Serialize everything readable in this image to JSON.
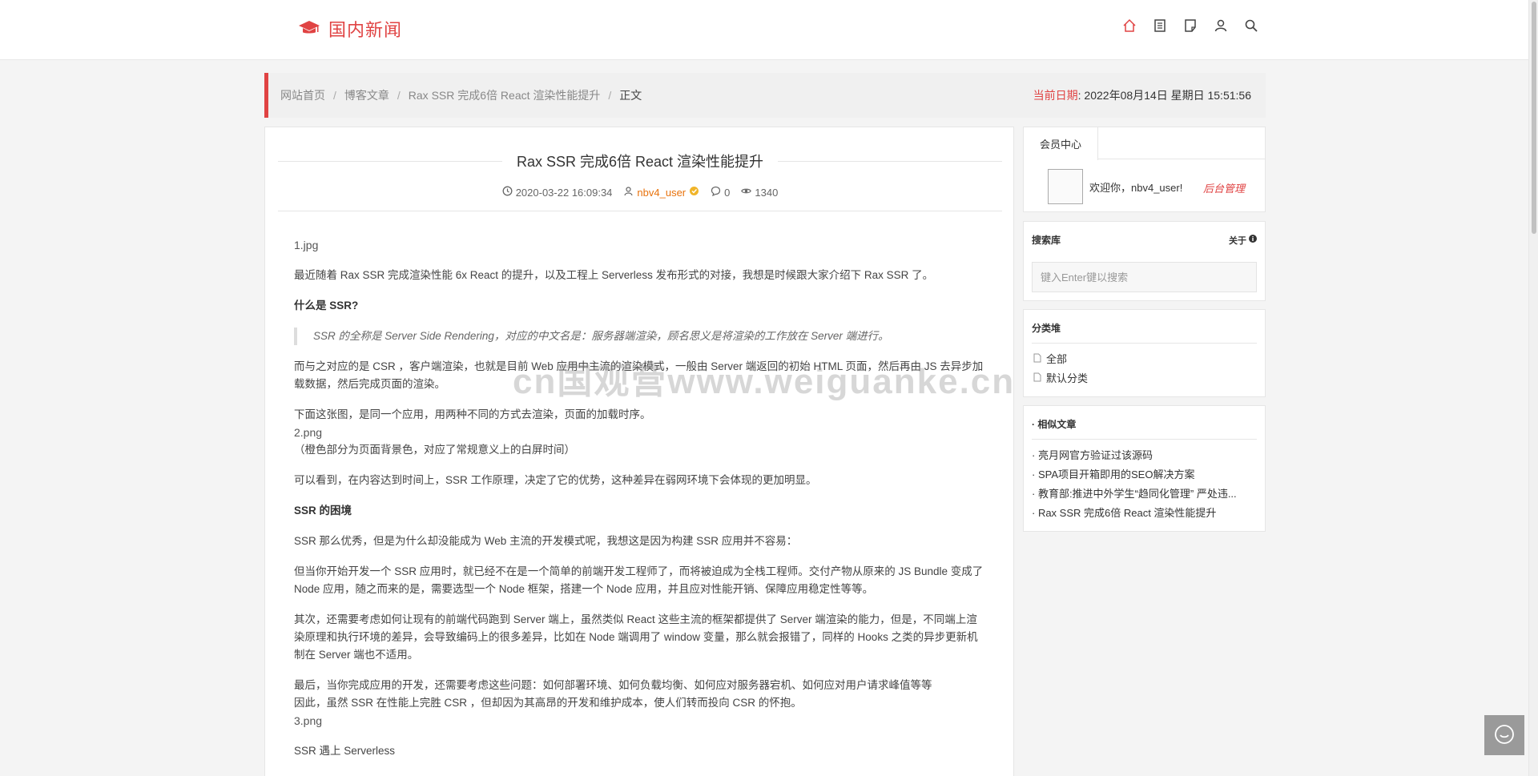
{
  "header": {
    "logo_text": "国内新闻",
    "icons": [
      "home-icon",
      "list-icon",
      "note-icon",
      "user-icon",
      "search-icon"
    ],
    "accent_color": "#e04343"
  },
  "breadcrumb": {
    "items": [
      "网站首页",
      "博客文章",
      "Rax SSR 完成6倍 React 渲染性能提升",
      "正文"
    ],
    "sep": "/"
  },
  "date": {
    "label": "当前日期",
    "colon": ":",
    "value": "2022年08月14日 星期日 15:51:56"
  },
  "article": {
    "title": "Rax SSR 完成6倍 React 渲染性能提升",
    "datetime": "2020-03-22 16:09:34",
    "author": "nbv4_user",
    "comments": "0",
    "views": "1340",
    "img1": "1.jpg",
    "p1": "最近随着 Rax SSR 完成渲染性能 6x React 的提升，以及工程上 Serverless 发布形式的对接，我想是时候跟大家介绍下 Rax SSR 了。",
    "h1": "什么是 SSR?",
    "quote": "SSR 的全称是 Server Side Rendering，对应的中文名是：服务器端渲染，顾名思义是将渲染的工作放在 Server 端进行。",
    "p2": "而与之对应的是 CSR ，客户端渲染，也就是目前 Web 应用中主流的渲染模式，一般由 Server 端返回的初始 HTML 页面，然后再由 JS 去异步加载数据，然后完成页面的渲染。",
    "p3": "下面这张图，是同一个应用，用两种不同的方式去渲染，页面的加载时序。",
    "img2": "2.png",
    "p3b": "（橙色部分为页面背景色，对应了常规意义上的白屏时间）",
    "p4": "可以看到，在内容达到时间上，SSR 工作原理，决定了它的优势，这种差异在弱网环境下会体现的更加明显。",
    "h2": "SSR 的困境",
    "p5": "SSR 那么优秀，但是为什么却没能成为 Web 主流的开发模式呢，我想这是因为构建 SSR 应用并不容易：",
    "p6": "但当你开始开发一个 SSR 应用时，就已经不在是一个简单的前端开发工程师了，而将被迫成为全栈工程师。交付产物从原来的 JS Bundle 变成了 Node 应用，随之而来的是，需要选型一个 Node 框架，搭建一个 Node 应用，并且应对性能开销、保障应用稳定性等等。",
    "p7": "其次，还需要考虑如何让现有的前端代码跑到 Server 端上，虽然类似 React 这些主流的框架都提供了 Server 端渲染的能力，但是，不同端上渲染原理和执行环境的差异，会导致编码上的很多差异，比如在 Node 端调用了 window 变量，那么就会报错了，同样的 Hooks 之类的异步更新机制在 Server 端也不适用。",
    "p8": "最后，当你完成应用的开发，还需要考虑这些问题：如何部署环境、如何负载均衡、如何应对服务器宕机、如何应对用户请求峰值等等",
    "p8b": "因此，虽然 SSR 在性能上完胜 CSR ，但却因为其高昂的开发和维护成本，使人们转而投向 CSR 的怀抱。",
    "img3": "3.png",
    "h3": "SSR 遇上 Serverless"
  },
  "sidebar": {
    "member": {
      "tab": "会员中心",
      "welcome": "欢迎你，nbv4_user!",
      "admin": "后台管理"
    },
    "search": {
      "title": "搜索库",
      "about": "关于",
      "placeholder": "键入Enter键以搜索"
    },
    "categories": {
      "title": "分类堆",
      "items": [
        "全部",
        "默认分类"
      ]
    },
    "related": {
      "title": "· 相似文章",
      "items": [
        "· 亮月网官方验证过该源码",
        "· SPA项目开箱即用的SEO解决方案",
        "· 教育部:推进中外学生“趋同化管理” 严处违...",
        "· Rax SSR 完成6倍 React 渲染性能提升"
      ]
    }
  },
  "watermark": "cn国观营www.weiguanke.cn"
}
